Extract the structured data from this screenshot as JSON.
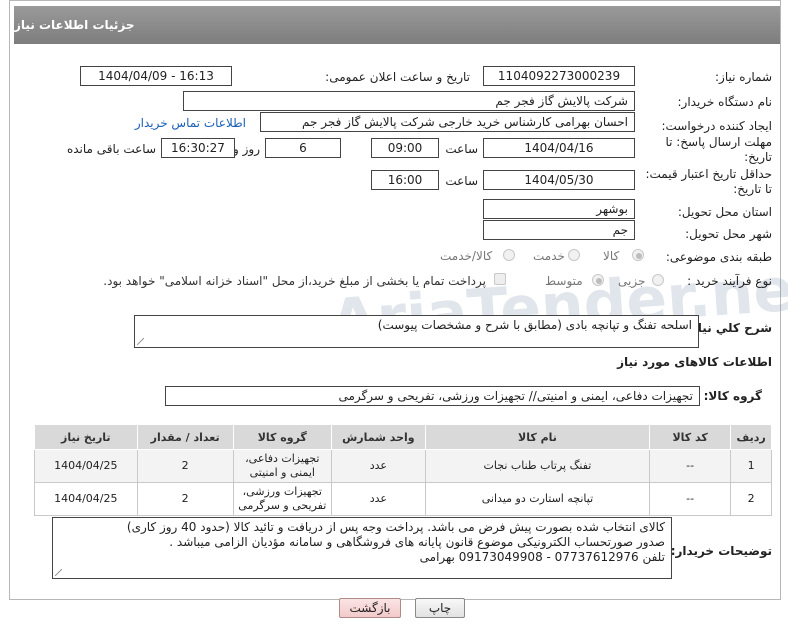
{
  "header": {
    "title": "جزئیات اطلاعات نیاز"
  },
  "fields": {
    "need_number_label": "شماره نیاز:",
    "need_number": "1104092273000239",
    "announce_label": "تاریخ و ساعت اعلان عمومی:",
    "announce_value": "1404/04/09 - 16:13",
    "buyer_org_label": "نام دستگاه خریدار:",
    "buyer_org": "شرکت پالایش گاز فجر جم",
    "creator_label": "ایجاد کننده درخواست:",
    "creator": "احسان بهرامی کارشناس خرید خارجی شرکت پالایش گاز فجر جم",
    "contact_link": "اطلاعات تماس خریدار",
    "deadline_label_1": "مهلت ارسال پاسخ: تا",
    "deadline_label_2": "تاریخ:",
    "deadline_date": "1404/04/16",
    "time_label": "ساعت",
    "deadline_time": "09:00",
    "days_value": "6",
    "days_label": "روز و",
    "remaining_time": "16:30:27",
    "remaining_label": "ساعت باقی مانده",
    "validity_label_1": "حداقل تاریخ اعتبار قیمت:",
    "validity_label_2": "تا تاریخ:",
    "validity_date": "1404/05/30",
    "validity_time": "16:00",
    "province_label": "استان محل تحویل:",
    "province": "بوشهر",
    "city_label": "شهر محل تحویل:",
    "city": "جم",
    "category_label": "طبقه بندی موضوعی:",
    "category_options": [
      "کالا",
      "خدمت",
      "کالا/خدمت"
    ],
    "category_selected": "کالا",
    "process_label": "نوع فرآیند خرید :",
    "process_options": [
      "جزیی",
      "متوسط"
    ],
    "process_selected": "متوسط",
    "payment_note": "پرداخت تمام یا بخشی از مبلغ خرید،از محل \"اسناد خزانه اسلامی\" خواهد بود."
  },
  "description": {
    "label": "شرح کلي نياز:",
    "value": "اسلحه تفنگ و تپانچه بادی (مطابق با شرح و مشخصات پیوست)"
  },
  "goods_section": {
    "title": "اطلاعات کالاهای مورد نیاز",
    "group_label": "گروه کالا:",
    "group_value": "تجهیزات دفاعی، ایمنی و امنیتی// تجهیزات ورزشی، تفریحی و سرگرمی"
  },
  "table": {
    "headers": [
      "ردیف",
      "کد کالا",
      "نام کالا",
      "واحد شمارش",
      "گروه کالا",
      "تعداد / مقدار",
      "تاریخ نیاز"
    ],
    "rows": [
      [
        "1",
        "--",
        "تفنگ پرتاب طناب نجات",
        "عدد",
        "تجهیزات دفاعی، ایمنی و امنیتی",
        "2",
        "1404/04/25"
      ],
      [
        "2",
        "--",
        "تپانچه استارت دو میدانی",
        "عدد",
        "تجهیزات ورزشی، تفریحی و سرگرمی",
        "2",
        "1404/04/25"
      ]
    ]
  },
  "buyer_notes": {
    "label": "توضیحات خریدار:",
    "lines": [
      "کالای انتخاب شده بصورت پیش فرض می باشد. پرداخت وجه پس از دریافت و تائید کالا (حدود 40 روز کاری)",
      "صدور صورتحساب الکترونیکی موضوع قانون پایانه های فروشگاهی و سامانه مؤدیان الزامی میباشد .",
      "تلفن 07737612976 - 09173049908 بهرامی"
    ]
  },
  "buttons": {
    "print": "چاپ",
    "back": "بازگشت"
  },
  "watermark": {
    "text": "AriaTender.net"
  }
}
